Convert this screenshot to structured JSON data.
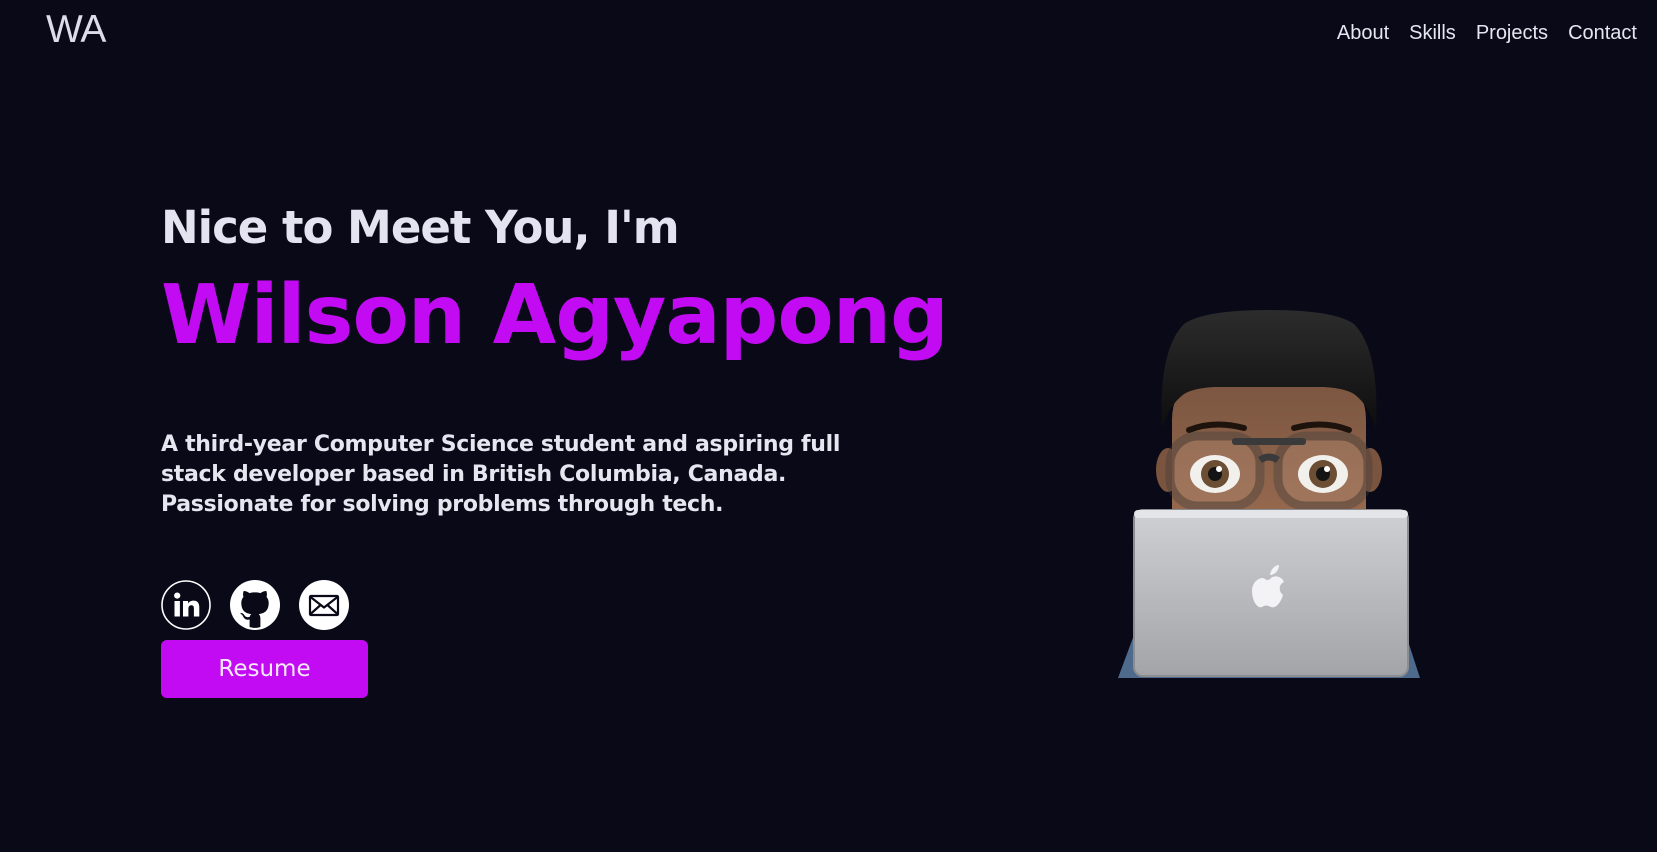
{
  "header": {
    "logo": "WA",
    "nav": [
      "About",
      "Skills",
      "Projects",
      "Contact"
    ]
  },
  "hero": {
    "greeting": "Nice to Meet You, I'm",
    "name": "Wilson Agyapong",
    "intro": "A third-year Computer Science student and aspiring full stack developer based in British Columbia, Canada. Passionate for solving problems through tech.",
    "resume_label": "Resume"
  },
  "socials": [
    {
      "icon": "linkedin-icon"
    },
    {
      "icon": "github-icon"
    },
    {
      "icon": "mail-icon"
    }
  ],
  "colors": {
    "background": "#0a0918",
    "accent": "#c20bf2",
    "text": "#e6e6f0"
  }
}
